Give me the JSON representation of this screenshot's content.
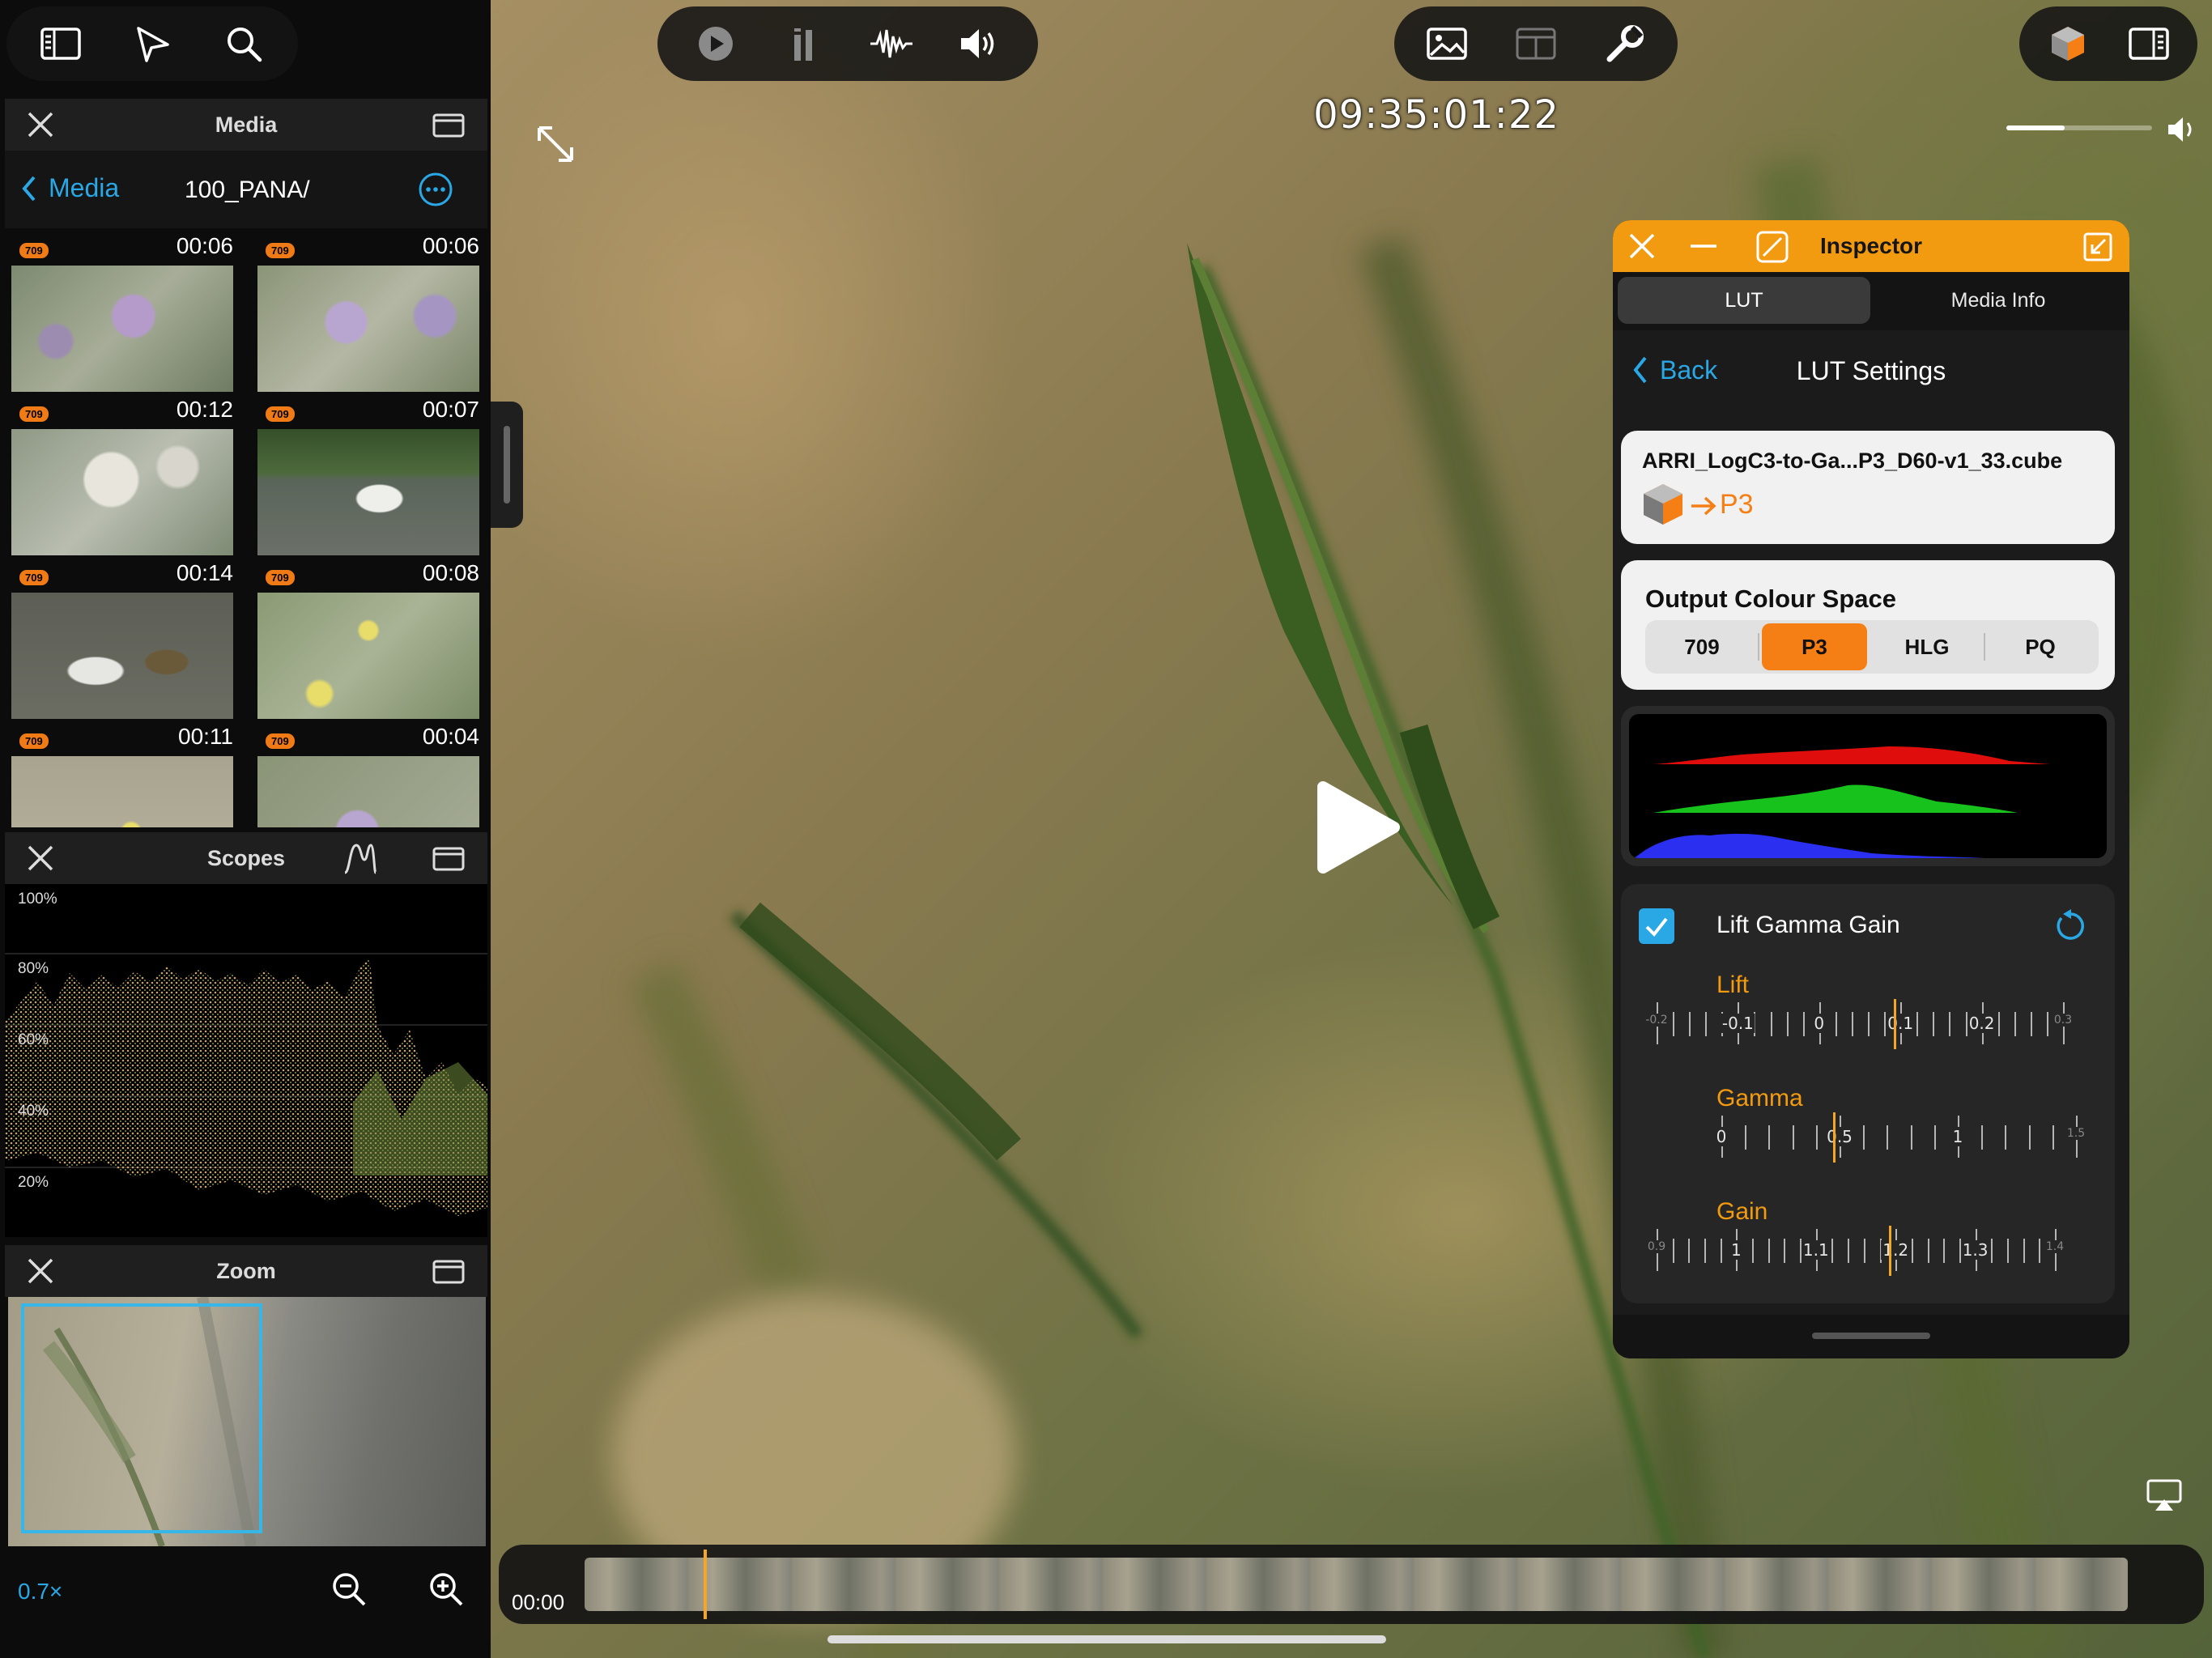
{
  "colors": {
    "accent": "#f29a10",
    "link": "#2aa7e5",
    "orange": "#f57f15",
    "badge": "#f07a16"
  },
  "toolbar_left": {
    "icons": [
      "sidebar-icon",
      "navigation-icon",
      "search-icon"
    ]
  },
  "toolbar_center": {
    "icons": [
      "play-circle-icon",
      "audio-meter-icon",
      "waveform-icon",
      "speaker-icon"
    ]
  },
  "toolbar_right": {
    "icons": [
      "image-icon",
      "layout-icon",
      "wrench-icon"
    ]
  },
  "toolbar_far_right": {
    "icons": [
      "lut-cube-icon",
      "right-sidebar-icon"
    ]
  },
  "viewer": {
    "timecode": "09:35:01:22",
    "volume_level": 0.4,
    "timeline_start": "00:00",
    "playhead_fraction": 0.077
  },
  "media_panel": {
    "title": "Media",
    "back_label": "Media",
    "folder": "100_PANA/",
    "clips": [
      {
        "badge": "709",
        "duration": "00:06"
      },
      {
        "badge": "709",
        "duration": "00:06"
      },
      {
        "badge": "709",
        "duration": "00:12"
      },
      {
        "badge": "709",
        "duration": "00:07"
      },
      {
        "badge": "709",
        "duration": "00:14"
      },
      {
        "badge": "709",
        "duration": "00:08"
      },
      {
        "badge": "709",
        "duration": "00:11"
      },
      {
        "badge": "709",
        "duration": "00:04"
      }
    ]
  },
  "scopes_panel": {
    "title": "Scopes",
    "levels": [
      "100%",
      "80%",
      "60%",
      "40%",
      "20%"
    ]
  },
  "zoom_panel": {
    "title": "Zoom",
    "zoom_level": "0.7×"
  },
  "inspector": {
    "title": "Inspector",
    "tabs": [
      "LUT",
      "Media Info"
    ],
    "active_tab": "LUT",
    "back_label": "Back",
    "page_title": "LUT Settings",
    "lut_file": "ARRI_LogC3-to-Ga...P3_D60-v1_33.cube",
    "lut_target": "P3",
    "output_section_title": "Output Colour Space",
    "output_options": [
      "709",
      "P3",
      "HLG",
      "PQ"
    ],
    "output_selected": "P3",
    "lgg_title": "Lift Gamma Gain",
    "lgg_enabled": true,
    "lift": {
      "label": "Lift",
      "value": 0.1,
      "ticks": [
        "-0.2",
        "-0.1",
        "0",
        "0.1",
        "0.2",
        "0.3"
      ]
    },
    "gamma": {
      "label": "Gamma",
      "value": 0.5,
      "ticks": [
        "0",
        "0.5",
        "1",
        "1.5"
      ]
    },
    "gain": {
      "label": "Gain",
      "value": 1.2,
      "ticks": [
        "0.9",
        "1",
        "1.1",
        "1.2",
        "1.3",
        "1.4"
      ]
    }
  }
}
